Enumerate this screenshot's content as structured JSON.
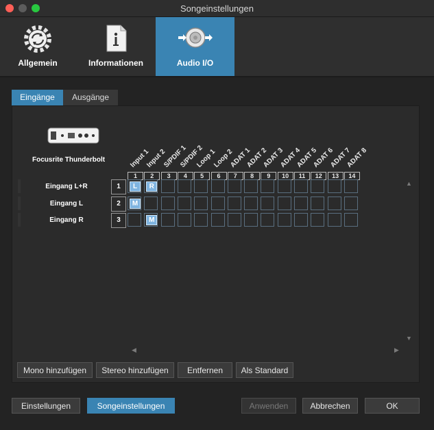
{
  "window": {
    "title": "Songeinstellungen"
  },
  "toolbar": {
    "items": [
      {
        "label": "Allgemein",
        "icon": "gear-sync-icon"
      },
      {
        "label": "Informationen",
        "icon": "info-document-icon"
      },
      {
        "label": "Audio I/O",
        "icon": "speaker-io-icon",
        "active": true
      }
    ]
  },
  "tabs": [
    {
      "label": "Eingänge",
      "active": true
    },
    {
      "label": "Ausgänge",
      "active": false
    }
  ],
  "device": {
    "name": "Focusrite Thunderbolt",
    "icon": "audio-interface-icon"
  },
  "columns": {
    "names": [
      "Input 1",
      "Input 2",
      "S/PDIF 1",
      "S/PDIF 2",
      "Loop 1",
      "Loop 2",
      "ADAT 1",
      "ADAT 2",
      "ADAT 3",
      "ADAT 4",
      "ADAT 5",
      "ADAT 6",
      "ADAT 7",
      "ADAT 8"
    ],
    "numbers": [
      "1",
      "2",
      "3",
      "4",
      "5",
      "6",
      "7",
      "8",
      "9",
      "10",
      "11",
      "12",
      "13",
      "14"
    ]
  },
  "rows": [
    {
      "label": "Eingang L+R",
      "num": "1",
      "assign": {
        "0": "L",
        "1": "R"
      }
    },
    {
      "label": "Eingang L",
      "num": "2",
      "assign": {
        "0": "M"
      }
    },
    {
      "label": "Eingang R",
      "num": "3",
      "assign": {
        "1": "M"
      }
    }
  ],
  "actions": {
    "mono": "Mono hinzufügen",
    "stereo": "Stereo hinzufügen",
    "remove": "Entfernen",
    "default": "Als Standard"
  },
  "footer": {
    "settings": "Einstellungen",
    "song_settings": "Songeinstellungen",
    "apply": "Anwenden",
    "cancel": "Abbrechen",
    "ok": "OK"
  },
  "colors": {
    "accent": "#3a84b3",
    "badge": "#7fb4e0"
  }
}
